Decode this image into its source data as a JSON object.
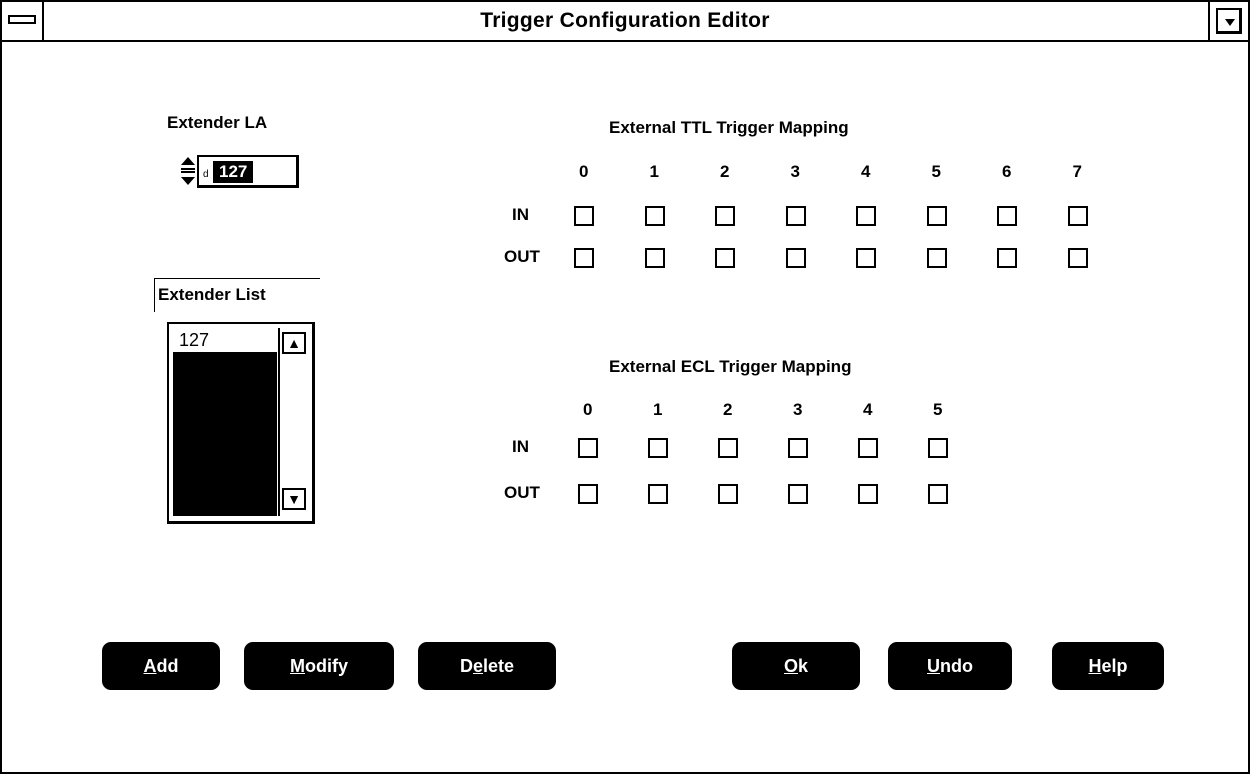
{
  "window": {
    "title": "Trigger Configuration Editor"
  },
  "extender_la": {
    "label": "Extender LA",
    "value": "127"
  },
  "extender_list": {
    "label": "Extender List",
    "items": [
      "127"
    ],
    "scroll_up": "▲",
    "scroll_down": "▼"
  },
  "ttl": {
    "title": "External TTL Trigger Mapping",
    "columns": [
      "0",
      "1",
      "2",
      "3",
      "4",
      "5",
      "6",
      "7"
    ],
    "row_in": "IN",
    "row_out": "OUT",
    "in_checked": [
      false,
      false,
      false,
      false,
      false,
      false,
      false,
      false
    ],
    "out_checked": [
      false,
      false,
      false,
      false,
      false,
      false,
      false,
      false
    ]
  },
  "ecl": {
    "title": "External ECL Trigger Mapping",
    "columns": [
      "0",
      "1",
      "2",
      "3",
      "4",
      "5"
    ],
    "row_in": "IN",
    "row_out": "OUT",
    "in_checked": [
      false,
      false,
      false,
      false,
      false,
      false
    ],
    "out_checked": [
      false,
      false,
      false,
      false,
      false,
      false
    ]
  },
  "buttons": {
    "add": {
      "mnemonic": "A",
      "rest": "dd"
    },
    "modify": {
      "mnemonic": "M",
      "rest": "odify"
    },
    "delete": {
      "pre": "D",
      "mnemonic": "e",
      "rest": "lete"
    },
    "ok": {
      "mnemonic": "O",
      "rest": "k"
    },
    "undo": {
      "mnemonic": "U",
      "rest": "ndo"
    },
    "help": {
      "mnemonic": "H",
      "rest": "elp"
    }
  }
}
